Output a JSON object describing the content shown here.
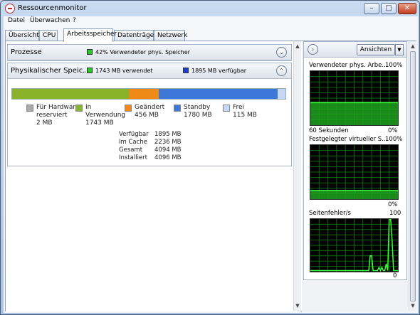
{
  "window": {
    "title": "Ressourcenmonitor",
    "buttons": {
      "minimize": "–",
      "maximize": "□",
      "close": "✕"
    }
  },
  "menu": [
    "Datei",
    "Überwachen",
    "?"
  ],
  "tabs": [
    "Übersicht",
    "CPU",
    "Arbeitsspeicher",
    "Datenträger",
    "Netzwerk"
  ],
  "active_tab": "Arbeitsspeicher",
  "processes": {
    "title": "Prozesse",
    "used_text": "42% Verwendeter phys. Speicher",
    "used_color": "#22cc22",
    "collapse_icon": "chevron-down-icon"
  },
  "physical": {
    "title": "Physikalischer Speic...",
    "used_text": "1743 MB verwendet",
    "used_color": "#22cc22",
    "free_text": "1895 MB verfügbar",
    "free_color": "#1a3fd6",
    "collapse_icon": "chevron-up-icon",
    "bar_total_mb": 4096,
    "bar": [
      {
        "name": "hardware",
        "mb": 2,
        "color": "#a9a9a9"
      },
      {
        "name": "in-use",
        "mb": 1743,
        "color": "#8ab32a"
      },
      {
        "name": "modified",
        "mb": 456,
        "color": "#ef8a16"
      },
      {
        "name": "standby",
        "mb": 1780,
        "color": "#3b78d8"
      },
      {
        "name": "free",
        "mb": 115,
        "color": "#c5d7f5"
      }
    ],
    "legend": [
      {
        "line1": "Für Hardware",
        "line2": "reserviert",
        "value": "2 MB",
        "color": "#a9a9a9"
      },
      {
        "line1": "In",
        "line2": "Verwendung",
        "value": "1743 MB",
        "color": "#8ab32a"
      },
      {
        "line1": "Geändert",
        "line2": "",
        "value": "456 MB",
        "color": "#ef8a16"
      },
      {
        "line1": "Standby",
        "line2": "",
        "value": "1780 MB",
        "color": "#3b78d8"
      },
      {
        "line1": "Frei",
        "line2": "",
        "value": "115 MB",
        "color": "#c5d7f5"
      }
    ],
    "stats": [
      {
        "label": "Verfügbar",
        "value": "1895 MB"
      },
      {
        "label": "Im Cache",
        "value": "2236 MB"
      },
      {
        "label": "Gesamt",
        "value": "4094 MB"
      },
      {
        "label": "Installiert",
        "value": "4096 MB"
      }
    ]
  },
  "right": {
    "nav_icon": "chevron-right-icon",
    "views_button": "Ansichten",
    "views_dropdown_icon": "dropdown-arrow-icon",
    "graphs": [
      {
        "label": "Verwendeter phys. Arbe...",
        "max": "100%",
        "bottom_left": "60 Sekunden",
        "bottom_right": "0%",
        "fill_fraction": 0.42
      },
      {
        "label": "Festgelegter virtueller S...",
        "max": "100%",
        "bottom_left": "",
        "bottom_right": "0%",
        "fill_fraction": 0.16
      },
      {
        "label": "Seitenfehler/s",
        "max": "100",
        "bottom_left": "",
        "bottom_right": "0",
        "fill_fraction": 0.0
      }
    ]
  }
}
